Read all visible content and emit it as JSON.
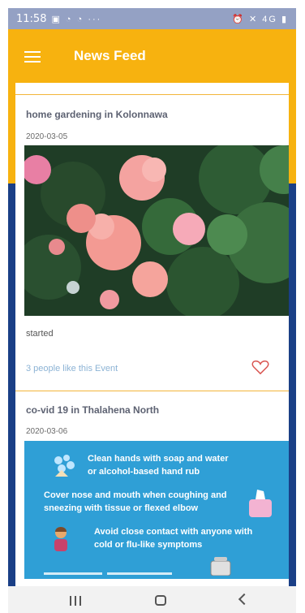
{
  "status_bar": {
    "time": "11:58",
    "left_icons": "▣ ◔ ◔ ···",
    "right_icons": "⏰ ✕ 4G ▮"
  },
  "app_bar": {
    "title": "News Feed",
    "menu_icon": "hamburger-menu-icon"
  },
  "posts": [
    {
      "title": "home gardening  in Kolonnawa",
      "date": "2020-03-05",
      "description": "started",
      "likes_text": "3 people like this Event"
    },
    {
      "title": "co-vid 19 in Thalahena North",
      "date": "2020-03-06",
      "poster_lines": [
        "Clean hands with soap and water",
        "or alcohol-based hand rub",
        "Cover nose and mouth when coughing and",
        "sneezing with tissue or flexed elbow",
        "Avoid close contact with anyone with",
        "cold or flu-like symptoms"
      ]
    }
  ],
  "colors": {
    "accent": "#f7b20f",
    "background": "#1a3f86",
    "like_text": "#8cb3d5",
    "heart": "#d9534f",
    "poster": "#2f9fd6"
  }
}
